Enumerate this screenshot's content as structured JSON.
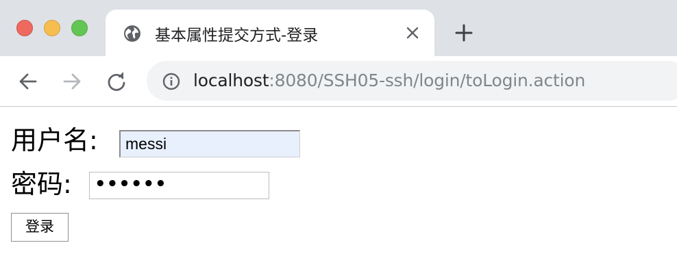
{
  "window": {
    "controls": [
      "close",
      "minimize",
      "maximize"
    ],
    "colors": {
      "close": "#ee6a5f",
      "minimize": "#f5be4f",
      "maximize": "#62c655",
      "tabstrip": "#dee1e6"
    }
  },
  "tab": {
    "title": "基本属性提交方式-登录",
    "icon": "globe-icon",
    "close_icon": "close-icon"
  },
  "toolbar": {
    "back_icon": "back-arrow-icon",
    "forward_icon": "forward-arrow-icon",
    "reload_icon": "reload-icon",
    "new_tab_icon": "plus-icon"
  },
  "address_bar": {
    "security_icon": "info-icon",
    "url_host": "localhost",
    "url_rest": ":8080/SSH05-ssh/login/toLogin.action"
  },
  "form": {
    "username_label": "用户名:",
    "username_value": "messi",
    "password_label": "密码:",
    "password_value": "••••••",
    "submit_label": "登录"
  }
}
